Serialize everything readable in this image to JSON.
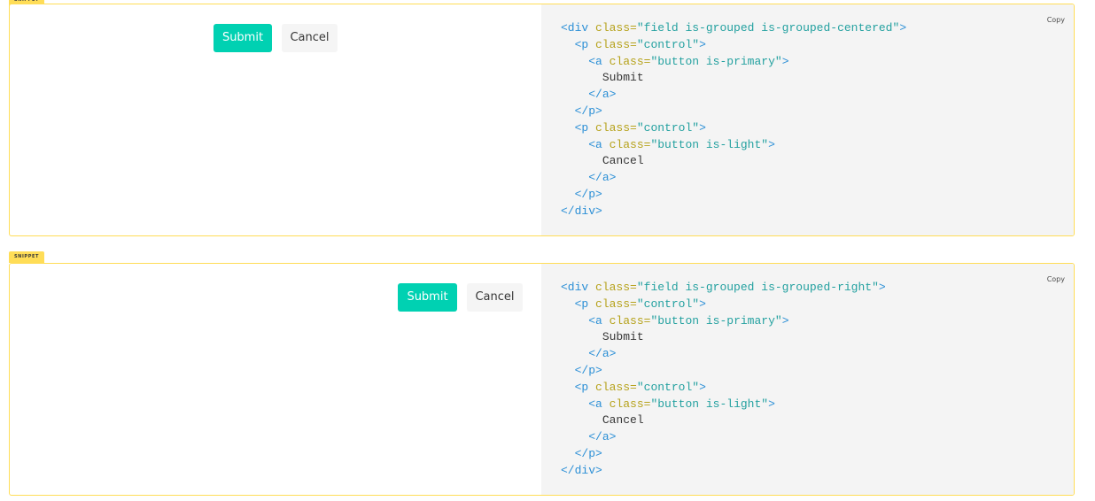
{
  "snippet_tag": "SNIPPET",
  "copy_label": "Copy",
  "snippets": [
    {
      "buttons": {
        "submit": "Submit",
        "cancel": "Cancel"
      },
      "code": {
        "div_class": "field is-grouped is-grouped-centered",
        "p_class": "control",
        "primary_class": "button is-primary",
        "light_class": "button is-light",
        "submit_text": "Submit",
        "cancel_text": "Cancel"
      }
    },
    {
      "buttons": {
        "submit": "Submit",
        "cancel": "Cancel"
      },
      "code": {
        "div_class": "field is-grouped is-grouped-right",
        "p_class": "control",
        "primary_class": "button is-primary",
        "light_class": "button is-light",
        "submit_text": "Submit",
        "cancel_text": "Cancel"
      }
    }
  ],
  "colors": {
    "primary": "#00d1b2",
    "light": "#f5f5f5",
    "snippet_border": "#ffdd57",
    "code_bg": "#f4f4f4",
    "code_tag": "#2b8fd6",
    "code_attr": "#b6a21b",
    "code_string": "#24a1a0"
  }
}
